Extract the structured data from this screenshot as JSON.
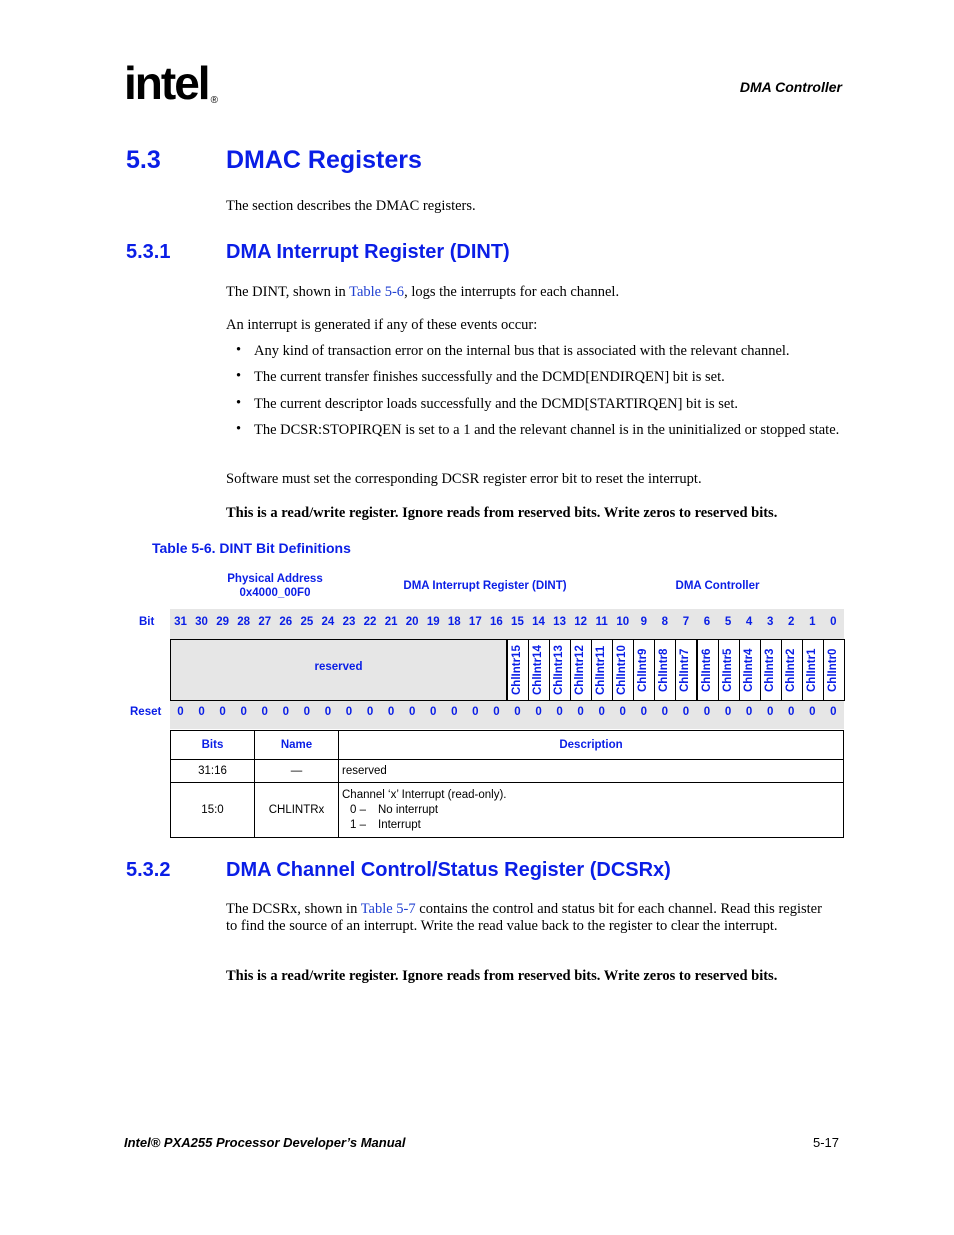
{
  "header": {
    "logo": "intel",
    "logo_mark": "®",
    "running_head": "DMA Controller"
  },
  "section_5_3": {
    "number": "5.3",
    "title": "DMAC Registers",
    "intro": "The section describes the DMAC registers."
  },
  "section_5_3_1": {
    "number": "5.3.1",
    "title": "DMA Interrupt Register (DINT)",
    "p1_before": "The DINT, shown in ",
    "p1_link": "Table 5-6",
    "p1_after": ", logs the interrupts for each channel.",
    "p2": "An interrupt is generated if any of these events occur:",
    "bullets": [
      "Any kind of transaction error on the internal bus that is associated with the relevant channel.",
      "The current transfer finishes successfully and the DCMD[ENDIRQEN] bit is set.",
      "The current descriptor loads successfully and the DCMD[STARTIRQEN] bit is set.",
      "The DCSR:STOPIRQEN is set to a 1 and the relevant channel is in the uninitialized or stopped state."
    ],
    "p3": "Software must set the corresponding DCSR register error bit to reset the interrupt.",
    "p4": "This is a read/write register. Ignore reads from reserved bits. Write zeros to reserved bits."
  },
  "table_5_6": {
    "caption": "Table 5-6. DINT Bit Definitions",
    "physical_address_label": "Physical Address",
    "physical_address": "0x4000_00F0",
    "register_name": "DMA Interrupt Register (DINT)",
    "unit": "DMA Controller",
    "bit_label": "Bit",
    "reset_label": "Reset",
    "bits": [
      "31",
      "30",
      "29",
      "28",
      "27",
      "26",
      "25",
      "24",
      "23",
      "22",
      "21",
      "20",
      "19",
      "18",
      "17",
      "16",
      "15",
      "14",
      "13",
      "12",
      "11",
      "10",
      "9",
      "8",
      "7",
      "6",
      "5",
      "4",
      "3",
      "2",
      "1",
      "0"
    ],
    "reserved_label": "reserved",
    "fields": [
      "ChlIntr15",
      "ChlIntr14",
      "ChlIntr13",
      "ChlIntr12",
      "ChlIntr11",
      "ChlIntr10",
      "ChlIntr9",
      "ChlIntr8",
      "ChlIntr7",
      "ChlIntr6",
      "ChlIntr5",
      "ChlIntr4",
      "ChlIntr3",
      "ChlIntr2",
      "ChlIntr1",
      "ChlIntr0"
    ],
    "reset_values": [
      "0",
      "0",
      "0",
      "0",
      "0",
      "0",
      "0",
      "0",
      "0",
      "0",
      "0",
      "0",
      "0",
      "0",
      "0",
      "0",
      "0",
      "0",
      "0",
      "0",
      "0",
      "0",
      "0",
      "0",
      "0",
      "0",
      "0",
      "0",
      "0",
      "0",
      "0",
      "0"
    ],
    "columns": [
      "Bits",
      "Name",
      "Description"
    ],
    "rows": [
      {
        "bits": "31:16",
        "name": "—",
        "description": "reserved"
      },
      {
        "bits": "15:0",
        "name": "CHLINTRx",
        "description": "Channel ‘x’ Interrupt (read-only).",
        "values": [
          {
            "code": "0 –",
            "meaning": "No interrupt"
          },
          {
            "code": "1 –",
            "meaning": "Interrupt"
          }
        ]
      }
    ]
  },
  "section_5_3_2": {
    "number": "5.3.2",
    "title": "DMA Channel Control/Status Register (DCSRx)",
    "p1_before": "The DCSRx, shown in ",
    "p1_link": "Table 5-7",
    "p1_after": " contains the control and status bit for each channel. Read this register to find the source of an interrupt. Write the read value back to the register to clear the interrupt.",
    "p2": "This is a read/write register. Ignore reads from reserved bits. Write zeros to reserved bits."
  },
  "footer": {
    "manual_title": "Intel® PXA255 Processor Developer’s Manual",
    "page_number": "5-17"
  }
}
